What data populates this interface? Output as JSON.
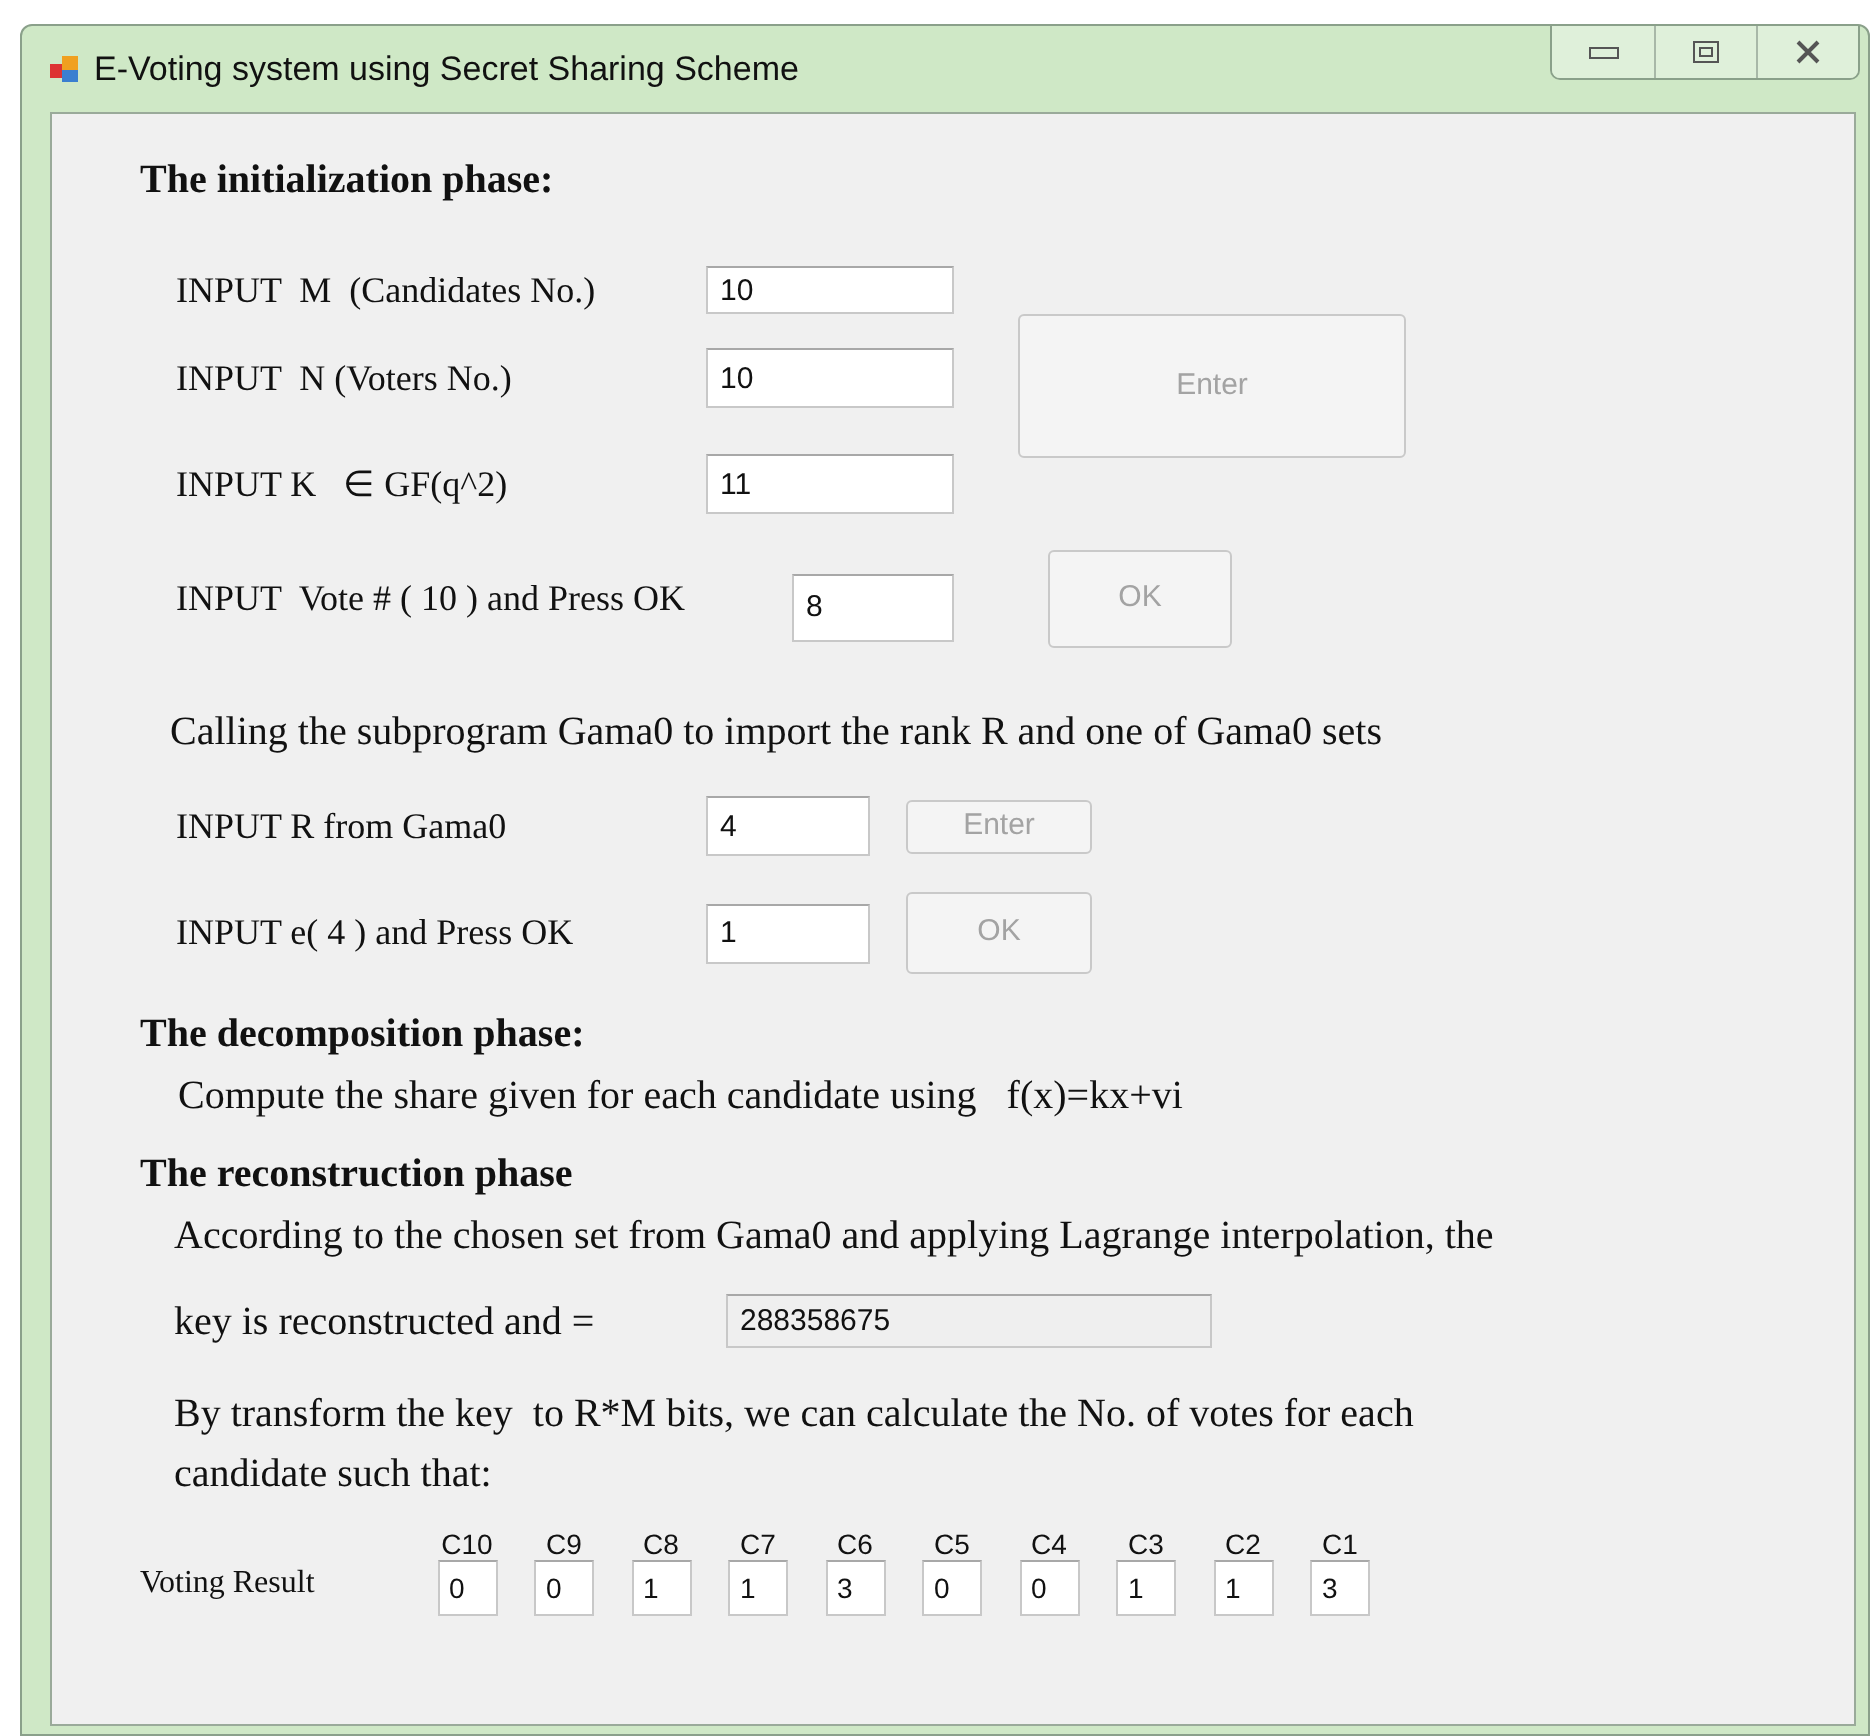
{
  "window": {
    "title": "E-Voting system using Secret Sharing Scheme"
  },
  "initialization": {
    "heading": "The initialization phase:",
    "fields": [
      {
        "label": "INPUT  M  (Candidates No.)",
        "value": "10"
      },
      {
        "label": "INPUT  N (Voters No.)",
        "value": "10"
      },
      {
        "label": "INPUT K   ∈ GF(q^2)",
        "value": "11"
      }
    ],
    "enter_button": {
      "label": "Enter",
      "disabled": true
    },
    "vote_field": {
      "label": "INPUT  Vote # ( 10 ) and Press OK",
      "value": "8"
    },
    "ok_button": {
      "label": "OK",
      "disabled": true
    }
  },
  "gama0": {
    "note": "Calling the subprogram Gama0 to import the rank R and one of Gama0 sets",
    "fields": [
      {
        "label": "INPUT R from Gama0",
        "value": "4",
        "button": {
          "label": "Enter",
          "disabled": true
        }
      },
      {
        "label": "INPUT e( 4 ) and Press OK",
        "value": "1",
        "button": {
          "label": "OK",
          "disabled": true
        }
      }
    ]
  },
  "decomposition": {
    "heading": "The decomposition phase:",
    "text": "Compute the share given for each candidate using   f(x)=kx+vi"
  },
  "reconstruction": {
    "heading": "The reconstruction phase",
    "text": "According to the chosen set from Gama0 and applying Lagrange interpolation, the",
    "key_label": "key is reconstructed and =",
    "key_value": "288358675",
    "key_readonly": true,
    "result_text": "By transform the key  to R*M bits, we can calculate the No. of votes for each candidate such that:"
  },
  "voting_result": {
    "label": "Voting Result",
    "candidates": [
      {
        "name": "C10",
        "votes": "0"
      },
      {
        "name": "C9",
        "votes": "0"
      },
      {
        "name": "C8",
        "votes": "1"
      },
      {
        "name": "C7",
        "votes": "1"
      },
      {
        "name": "C6",
        "votes": "3"
      },
      {
        "name": "C5",
        "votes": "0"
      },
      {
        "name": "C4",
        "votes": "0"
      },
      {
        "name": "C3",
        "votes": "1"
      },
      {
        "name": "C2",
        "votes": "1"
      },
      {
        "name": "C1",
        "votes": "3"
      }
    ]
  }
}
